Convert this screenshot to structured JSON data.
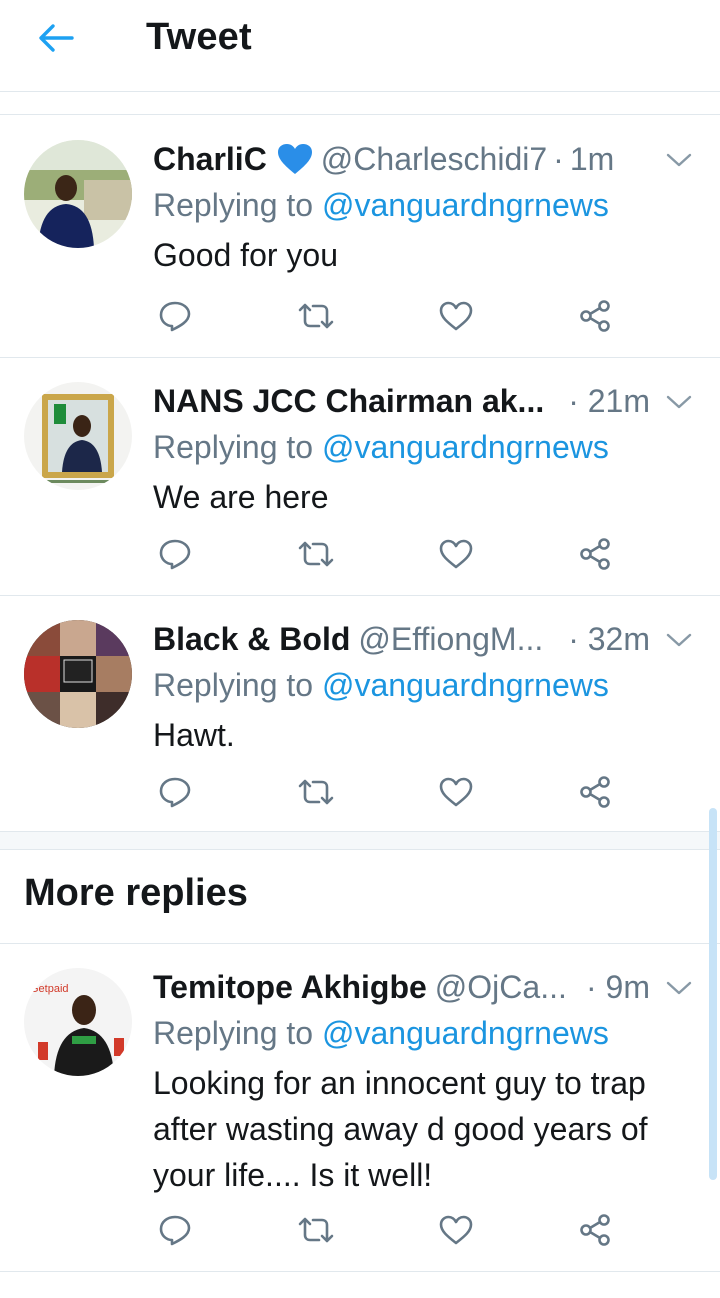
{
  "header": {
    "title": "Tweet",
    "back_icon": "arrow-left-icon",
    "accent": "#1da1f2"
  },
  "colors": {
    "link": "#1b95e0",
    "muted": "#657786",
    "divider": "#e1e8ed"
  },
  "tweets": [
    {
      "name": "CharliC",
      "emoji": "blue-heart-icon",
      "handle": "@Charleschidi7",
      "separator": "·",
      "time": "1m",
      "reply_prefix": "Replying to",
      "reply_to": "@vanguardngrnews",
      "text": "Good for you"
    },
    {
      "name": "NANS JCC Chairman ak...",
      "handle": "",
      "separator": "·",
      "time": "21m",
      "reply_prefix": "Replying to",
      "reply_to": "@vanguardngrnews",
      "text": "We are here"
    },
    {
      "name": "Black & Bold",
      "handle": "@EffiongM...",
      "separator": "·",
      "time": "32m",
      "reply_prefix": "Replying to",
      "reply_to": "@vanguardngrnews",
      "text": "Hawt."
    }
  ],
  "more_replies": {
    "title": "More replies",
    "tweets": [
      {
        "name": "Temitope Akhigbe",
        "handle": "@OjCa...",
        "separator": "·",
        "time": "9m",
        "reply_prefix": "Replying to",
        "reply_to": "@vanguardngrnews",
        "text": "Looking for an innocent guy to trap after wasting away d good years of your life.... Is it well!"
      }
    ]
  },
  "action_icons": [
    "reply-icon",
    "retweet-icon",
    "like-icon",
    "share-icon"
  ]
}
